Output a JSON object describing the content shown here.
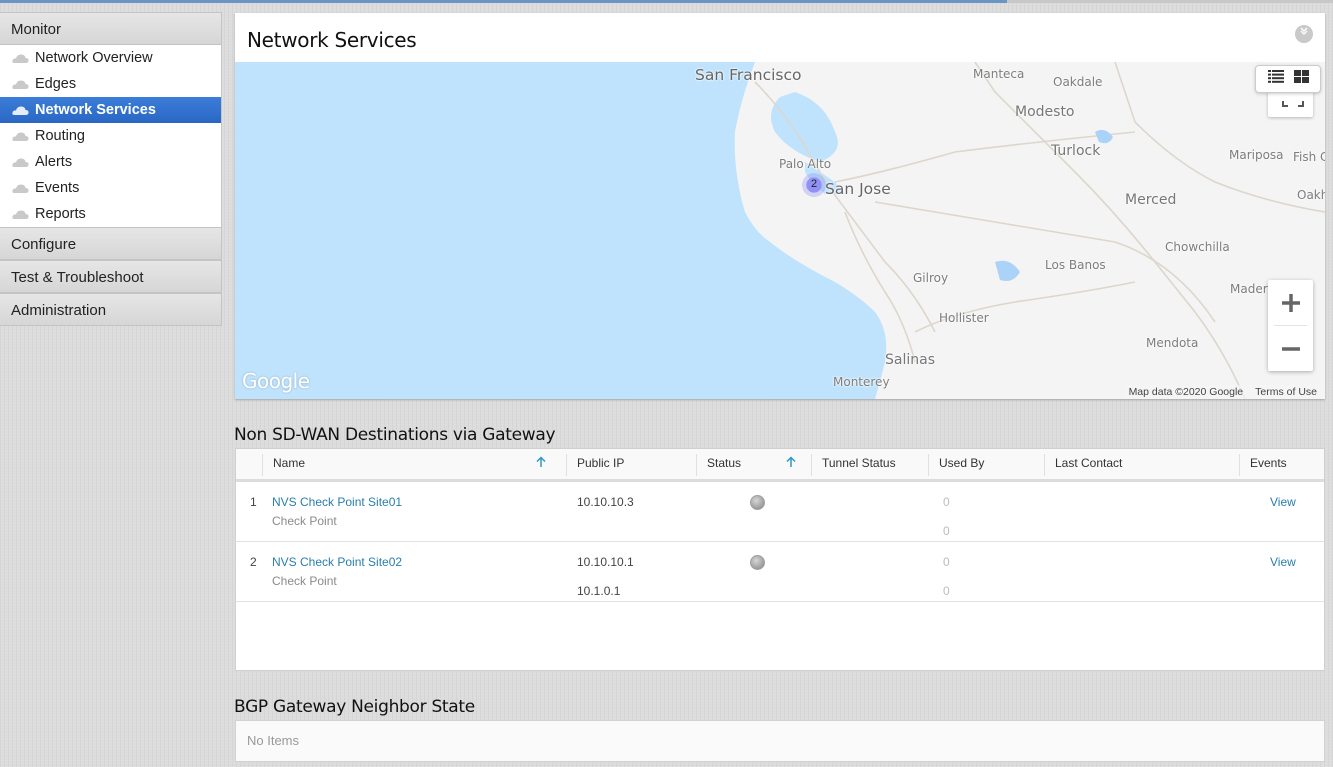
{
  "sidebar": {
    "sections": [
      {
        "label": "Monitor",
        "items": [
          {
            "label": "Network Overview",
            "icon": "cloud-icon",
            "active": false
          },
          {
            "label": "Edges",
            "icon": "cloud-icon",
            "active": false
          },
          {
            "label": "Network Services",
            "icon": "cloud-icon",
            "active": true
          },
          {
            "label": "Routing",
            "icon": "cloud-icon",
            "active": false
          },
          {
            "label": "Alerts",
            "icon": "cloud-icon",
            "active": false
          },
          {
            "label": "Events",
            "icon": "cloud-icon",
            "active": false
          },
          {
            "label": "Reports",
            "icon": "cloud-icon",
            "active": false
          }
        ]
      },
      {
        "label": "Configure"
      },
      {
        "label": "Test & Troubleshoot"
      },
      {
        "label": "Administration"
      }
    ]
  },
  "map_card": {
    "title": "Network Services",
    "collapse_icon": "double-chevron-down-icon",
    "cluster_count": "2",
    "labels": {
      "san_francisco": "San Francisco",
      "manteca": "Manteca",
      "oakdale": "Oakdale",
      "modesto": "Modesto",
      "turlock": "Turlock",
      "mariposa": "Mariposa",
      "fish_camp": "Fish C",
      "oakhurst": "Oakh",
      "palo_alto": "Palo Alto",
      "san_jose": "San Jose",
      "merced": "Merced",
      "chowchilla": "Chowchilla",
      "los_banos": "Los Banos",
      "gilroy": "Gilroy",
      "madera": "Madera",
      "hollister": "Hollister",
      "mendota": "Mendota",
      "salinas": "Salinas",
      "monterey": "Monterey"
    },
    "google_logo": "Google",
    "map_data": "Map data ©2020 Google",
    "terms": "Terms of Use",
    "controls": {
      "zoom_in": "+",
      "zoom_out": "−"
    }
  },
  "destinations": {
    "title": "Non SD-WAN Destinations via Gateway",
    "columns": [
      "Name",
      "Public IP",
      "Status",
      "Tunnel Status",
      "Used By",
      "Last Contact",
      "Events"
    ],
    "rows": [
      {
        "index": "1",
        "name": "NVS Check Point Site01",
        "type": "Check Point",
        "public_ips": [
          "10.10.10.3",
          ""
        ],
        "status": "unknown",
        "tunnel_status": "",
        "used_by": [
          "0",
          "0"
        ],
        "last_contact": "",
        "events": "View"
      },
      {
        "index": "2",
        "name": "NVS Check Point Site02",
        "type": "Check Point",
        "public_ips": [
          "10.10.10.1",
          "10.1.0.1"
        ],
        "status": "unknown",
        "tunnel_status": "",
        "used_by": [
          "0",
          "0"
        ],
        "last_contact": "",
        "events": "View"
      }
    ]
  },
  "bgp": {
    "title": "BGP Gateway Neighbor State",
    "empty_text": "No Items"
  }
}
